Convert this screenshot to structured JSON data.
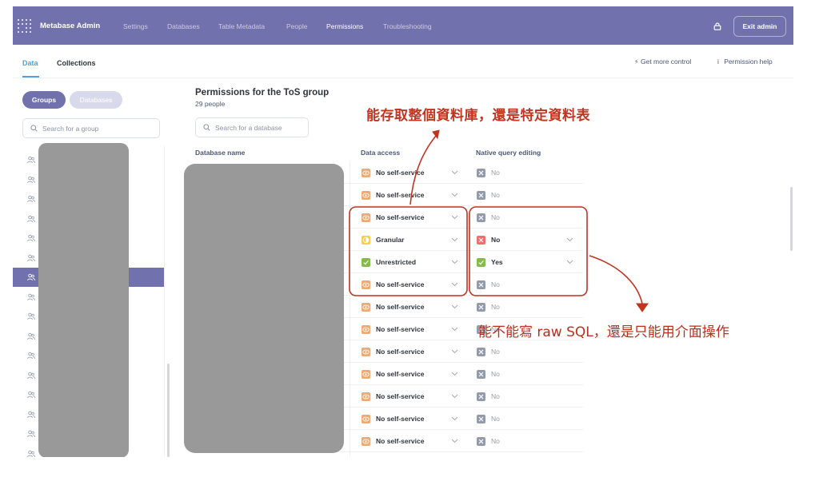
{
  "app": {
    "brand": "Metabase Admin",
    "exit_label": "Exit admin"
  },
  "nav": [
    "Settings",
    "Databases",
    "Table Metadata",
    "People",
    "Permissions",
    "Troubleshooting"
  ],
  "nav_active": "Permissions",
  "subtabs": [
    "Data",
    "Collections"
  ],
  "help": {
    "more_control": "Get more control",
    "permission_help": "Permission help"
  },
  "left": {
    "pills": [
      "Groups",
      "Databases"
    ],
    "search_placeholder": "Search for a group"
  },
  "main": {
    "title": "Permissions for the ToS group",
    "subtitle": "29 people",
    "search_placeholder": "Search for a database",
    "columns": [
      "Database name",
      "Data access",
      "Native query editing"
    ]
  },
  "rows": [
    {
      "access": "No self-service",
      "access_icon": "eye-icon",
      "native": "No",
      "native_icon": "x-gray"
    },
    {
      "access": "No self-service",
      "access_icon": "eye-icon",
      "native": "No",
      "native_icon": "x-gray"
    },
    {
      "access": "No self-service",
      "access_icon": "eye-icon",
      "native": "No",
      "native_icon": "x-gray"
    },
    {
      "access": "Granular",
      "access_icon": "granular-icon",
      "native": "No",
      "native_icon": "x-red",
      "native_chevron": true
    },
    {
      "access": "Unrestricted",
      "access_icon": "check-icon",
      "native": "Yes",
      "native_icon": "check-green",
      "native_chevron": true
    },
    {
      "access": "No self-service",
      "access_icon": "eye-icon",
      "native": "No",
      "native_icon": "x-gray"
    },
    {
      "access": "No self-service",
      "access_icon": "eye-icon",
      "native": "No",
      "native_icon": "x-gray"
    },
    {
      "access": "No self-service",
      "access_icon": "eye-icon",
      "native": "No",
      "native_icon": "x-gray"
    },
    {
      "access": "No self-service",
      "access_icon": "eye-icon",
      "native": "No",
      "native_icon": "x-gray"
    },
    {
      "access": "No self-service",
      "access_icon": "eye-icon",
      "native": "No",
      "native_icon": "x-gray"
    },
    {
      "access": "No self-service",
      "access_icon": "eye-icon",
      "native": "No",
      "native_icon": "x-gray"
    },
    {
      "access": "No self-service",
      "access_icon": "eye-icon",
      "native": "No",
      "native_icon": "x-gray"
    },
    {
      "access": "No self-service",
      "access_icon": "eye-icon",
      "native": "No",
      "native_icon": "x-gray"
    }
  ],
  "annotations": {
    "top": "能存取整個資料庫，還是特定資料表",
    "right": "能不能寫 raw SQL，還是只能用介面操作"
  },
  "colors": {
    "nav_bg": "#7172ad",
    "eye_orange": "#f2a86f",
    "granular_yellow": "#f9cf48",
    "check_green": "#84bb4c",
    "x_gray": "#949aab",
    "x_red": "#ed6e6e",
    "annotation_red": "#c1341f"
  }
}
